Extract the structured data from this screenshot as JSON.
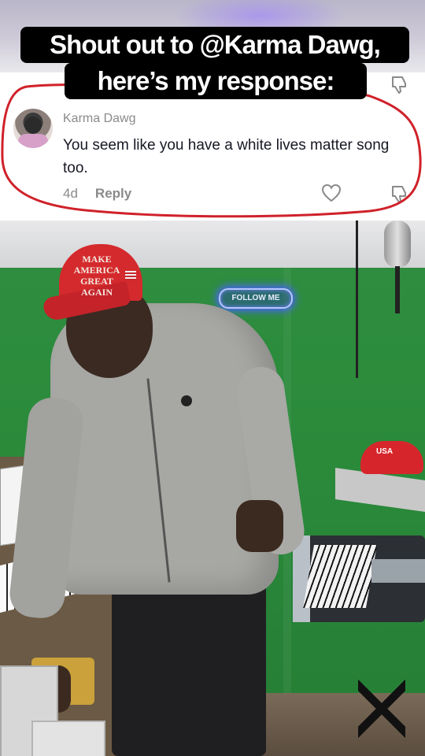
{
  "caption": {
    "line1": "Shout out to @Karma Dawg,",
    "line2": "here’s my response:"
  },
  "comment": {
    "username": "Karma Dawg",
    "text": "You seem like you have a white lives matter song too.",
    "age": "4d",
    "reply_label": "Reply",
    "icons": [
      "heart-icon",
      "dislike-icon"
    ]
  },
  "video": {
    "hat_text": "MAKE AMERICA GREAT AGAIN",
    "neon_sign": "FOLLOW ME",
    "cap_right_text": "USA"
  },
  "colors": {
    "annotation_red": "#d0212a",
    "caption_bg": "#000000",
    "caption_text": "#ffffff",
    "greenscreen": "#2a8a3a",
    "hat_red": "#d42a2d"
  }
}
